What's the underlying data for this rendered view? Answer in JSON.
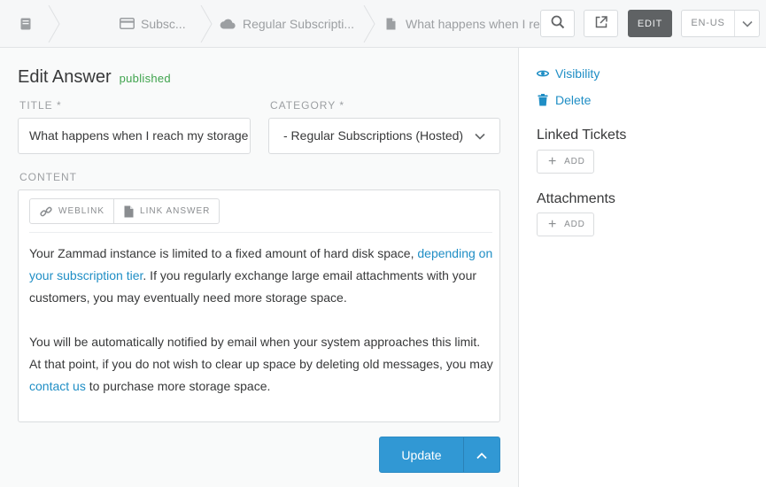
{
  "breadcrumb": {
    "items": [
      {
        "label": "",
        "icon": "knowledge-base-icon"
      },
      {
        "label": "Subsc...",
        "icon": "credit-card-icon"
      },
      {
        "label": "Regular Subscripti...",
        "icon": "cloud-icon"
      },
      {
        "label": "What happens when I reac...",
        "icon": "document-icon"
      }
    ]
  },
  "toolbar": {
    "search_icon": "search-icon",
    "open_external_icon": "external-link-icon",
    "edit_label": "EDIT",
    "locale_label": "EN-US"
  },
  "form": {
    "heading": "Edit Answer",
    "status_badge": "published",
    "title_label": "TITLE *",
    "title_value": "What happens when I reach my storage limit?",
    "category_label": "CATEGORY *",
    "category_value": "- Regular Subscriptions (Hosted)",
    "content_label": "CONTENT",
    "editor_buttons": {
      "weblink": "WEBLINK",
      "link_answer": "LINK ANSWER"
    },
    "content": {
      "p1_before": "Your Zammad instance is limited to a fixed amount of hard disk space, ",
      "p1_link": "depending on your subscription tier",
      "p1_after": ". If you regularly exchange large email attachments with your customers, you may eventually need more storage space.",
      "p2_before": "You will be automatically notified by email when your system approaches this limit. At that point, if you do not wish to clear up space by deleting old messages, you may ",
      "p2_link": "contact us",
      "p2_after": " to purchase more storage space."
    },
    "update_label": "Update"
  },
  "sidebar": {
    "visibility_label": "Visibility",
    "delete_label": "Delete",
    "linked_tickets_heading": "Linked Tickets",
    "linked_tickets_add": "ADD",
    "attachments_heading": "Attachments",
    "attachments_add": "ADD"
  },
  "colors": {
    "accent": "#1f8ec5",
    "primary_button": "#3198d4",
    "published": "#3fa34d",
    "edit_active": "#5f6264"
  }
}
